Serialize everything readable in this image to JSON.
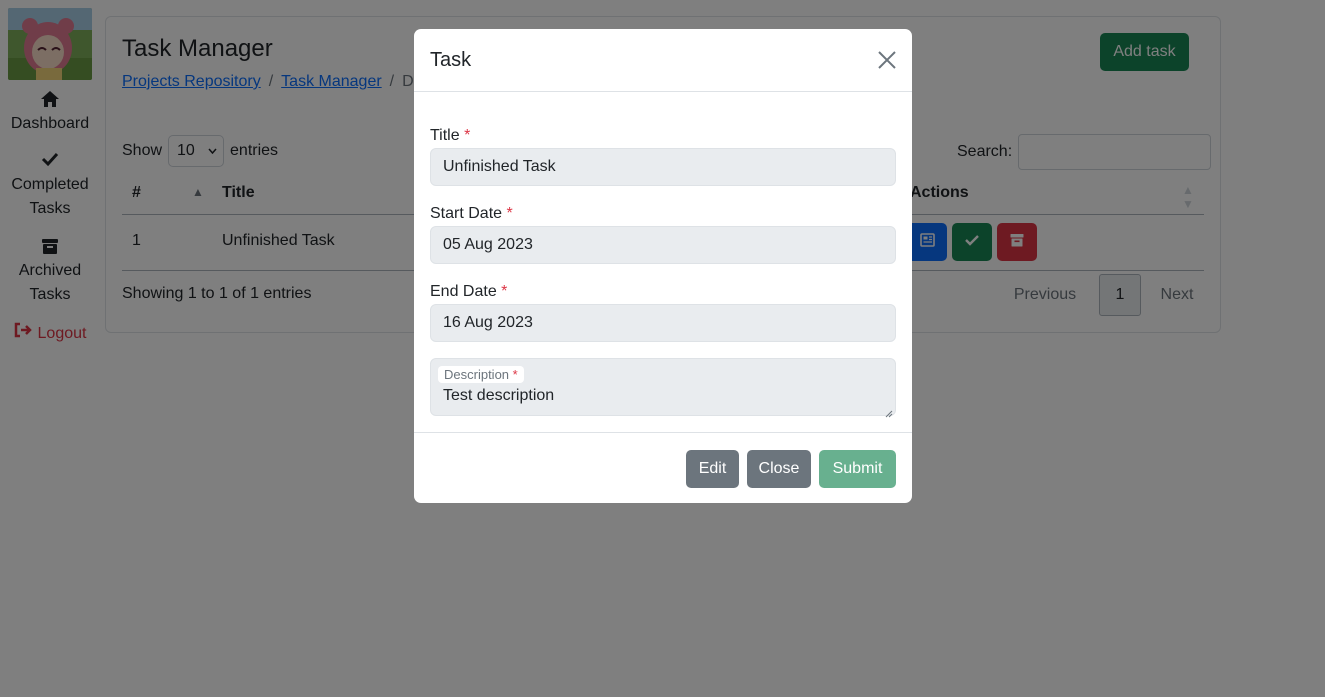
{
  "sidebar": {
    "items": [
      {
        "label": "Dashboard",
        "icon": "home-icon"
      },
      {
        "label": "Completed Tasks",
        "line1": "Completed",
        "line2": "Tasks",
        "icon": "check-icon"
      },
      {
        "label": "Archived Tasks",
        "line1": "Archived",
        "line2": "Tasks",
        "icon": "archive-icon"
      },
      {
        "label": "Logout",
        "icon": "sign-out-icon"
      }
    ]
  },
  "page": {
    "title": "Task Manager",
    "add_task_label": "Add task",
    "breadcrumb": [
      "Projects Repository",
      "Task Manager",
      "Da"
    ]
  },
  "table": {
    "show_label": "Show",
    "entries_label": "entries",
    "page_size": "10",
    "search_label": "Search:",
    "search_value": "",
    "columns": [
      "#",
      "Title",
      "Actions"
    ],
    "rows": [
      {
        "num": "1",
        "title": "Unfinished Task"
      }
    ],
    "info": "Showing 1 to 1 of 1 entries",
    "pagination": {
      "previous": "Previous",
      "current": "1",
      "next": "Next"
    }
  },
  "modal": {
    "title": "Task",
    "fields": {
      "title": {
        "label": "Title",
        "value": "Unfinished Task"
      },
      "start_date": {
        "label": "Start Date",
        "value": "05 Aug 2023"
      },
      "end_date": {
        "label": "End Date",
        "value": "16 Aug 2023"
      },
      "description": {
        "label": "Description",
        "value": "Test description"
      }
    },
    "required_marker": "*",
    "buttons": {
      "edit": "Edit",
      "close": "Close",
      "submit": "Submit"
    }
  },
  "colors": {
    "primary": "#0d6efd",
    "success": "#198754",
    "danger": "#dc3545",
    "secondary": "#6c757d"
  }
}
